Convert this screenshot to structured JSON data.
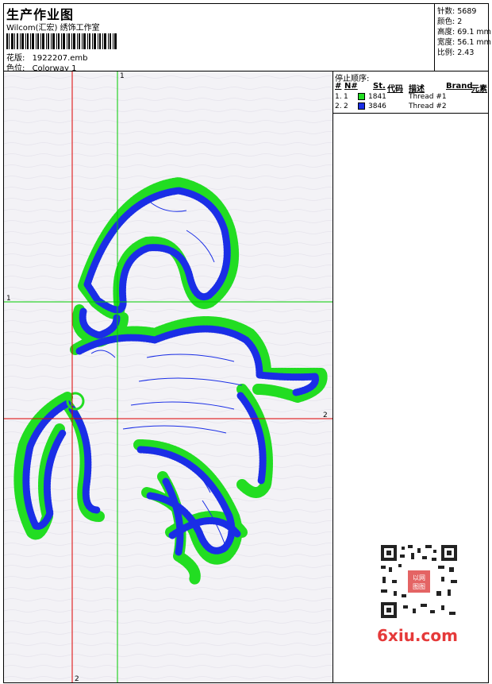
{
  "header": {
    "title": "生产作业图",
    "company": "Wilcom(汇宏) 绣饰工作室",
    "file_label": "花版:",
    "file_value": "1922207.emb",
    "colorway_label": "色位:",
    "colorway_value": "Colorway 1"
  },
  "stats": [
    {
      "label": "针数:",
      "value": "5689"
    },
    {
      "label": "颜色:",
      "value": "2"
    },
    {
      "label": "高度:",
      "value": "69.1 mm"
    },
    {
      "label": "宽度:",
      "value": "56.1 mm"
    },
    {
      "label": "比例:",
      "value": "2.43"
    }
  ],
  "stop_sequence": {
    "title": "停止顺序:",
    "columns": [
      "#",
      "N#",
      "St.",
      "代码",
      "描述",
      "Brand",
      "元素"
    ],
    "rows": [
      {
        "index": "1.",
        "n": "1",
        "color": "#22dd22",
        "code": "1841",
        "description": "Thread #1"
      },
      {
        "index": "2.",
        "n": "2",
        "color": "#1a2ee6",
        "code": "3846",
        "description": "Thread #2"
      }
    ]
  },
  "guides": {
    "vertical_label_top": "1",
    "vertical_label_bottom": "2",
    "horizontal_label_left": "1",
    "horizontal_label_right": "2"
  },
  "colors": {
    "thread1": "#22dd22",
    "thread2": "#1a2ee6",
    "guide_green": "#00cc00",
    "guide_red": "#dd0000",
    "canvas_bg": "#f3f2f6"
  },
  "watermark": {
    "text": "6xiu.com",
    "qr_stamp": "以网图图"
  }
}
